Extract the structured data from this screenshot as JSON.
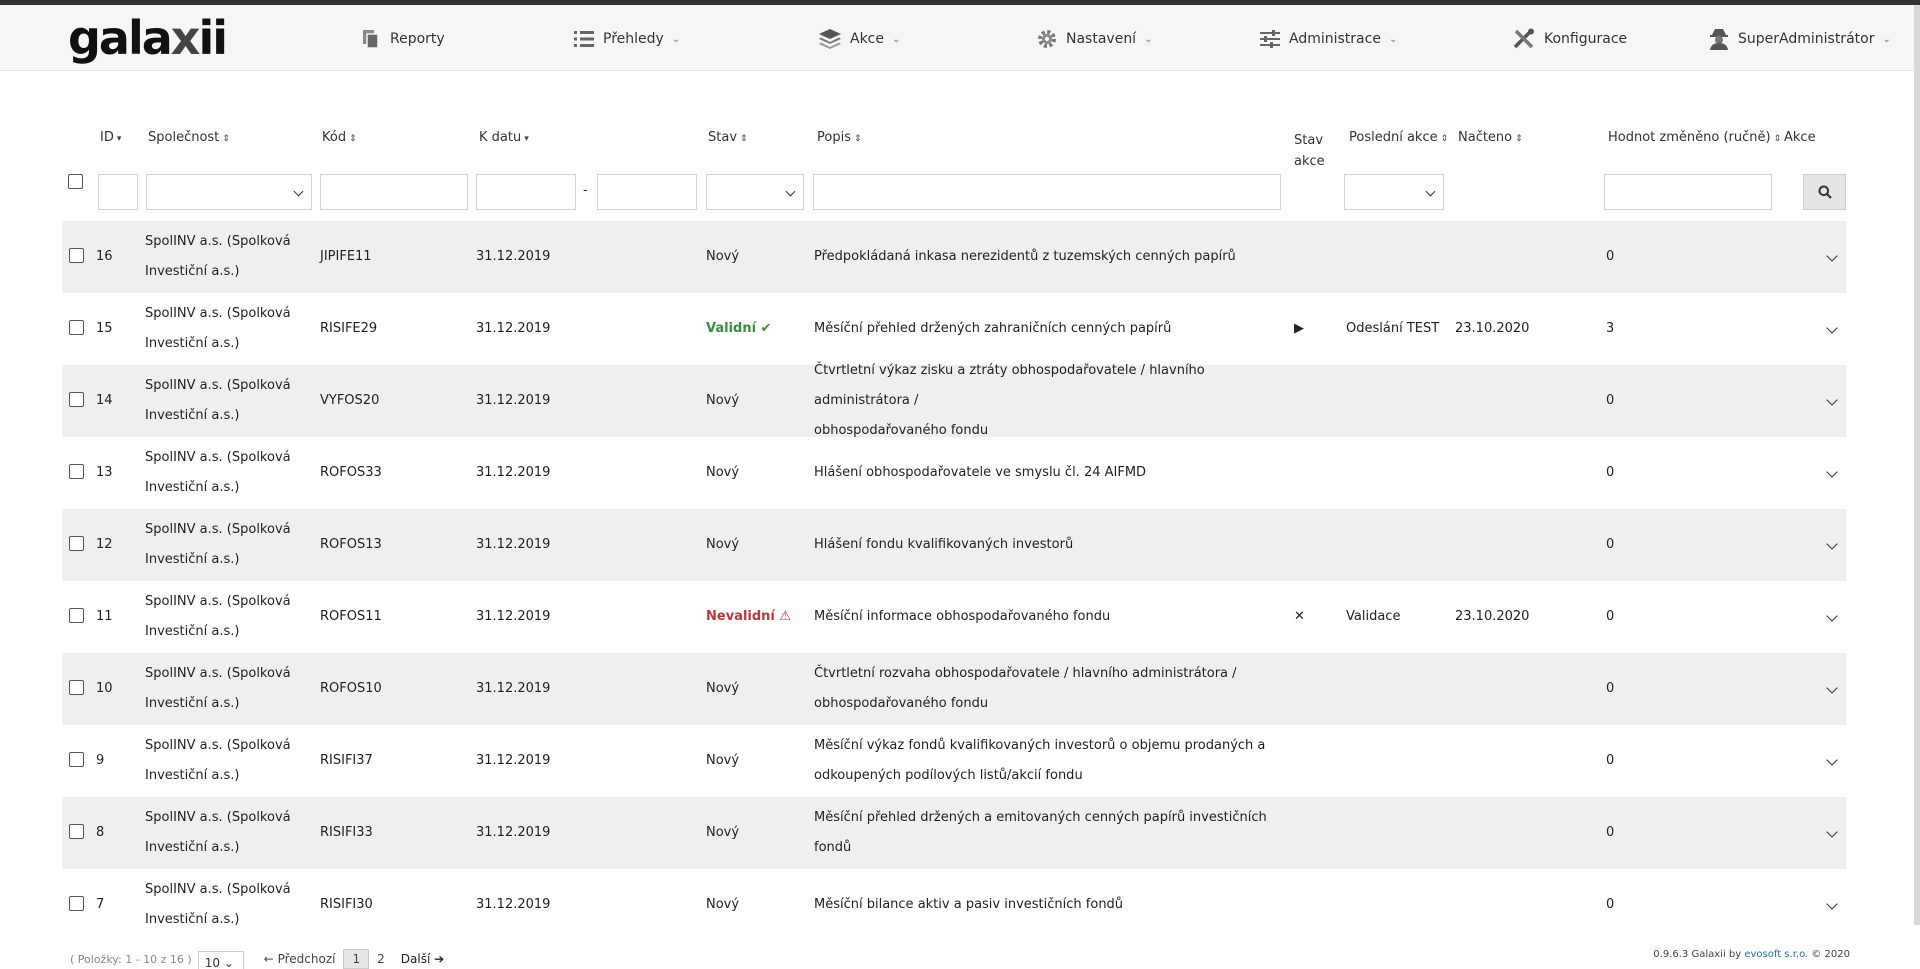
{
  "app": {
    "logo_text_a": "gala",
    "logo_text_x": "x",
    "logo_text_b": "ii"
  },
  "nav": {
    "reporty": "Reporty",
    "prehledy": "Přehledy",
    "akce": "Akce",
    "nastaveni": "Nastavení",
    "administrace": "Administrace",
    "konfigurace": "Konfigurace",
    "superadmin": "SuperAdministrátor"
  },
  "columns": {
    "id": "ID",
    "spolecnost": "Společnost",
    "kod": "Kód",
    "k_datu": "K datu",
    "stav": "Stav",
    "popis": "Popis",
    "stav_akce_1": "Stav",
    "stav_akce_2": "akce",
    "posledni_akce": "Poslední akce",
    "nacteno": "Načteno",
    "hodnot_zmeneno": "Hodnot změněno (ručně)",
    "akce": "Akce"
  },
  "filters": {
    "date_separator": "-"
  },
  "rows": [
    {
      "id": "16",
      "company_1": "SpolINV a.s. (Spolková",
      "company_2": "Investiční a.s.)",
      "code": "JIPIFE11",
      "date": "31.12.2019",
      "status": "Nový",
      "desc_1": "Předpokládaná inkasa nerezidentů z tuzemských cenných papírů",
      "desc_2": "",
      "action_state": "",
      "last_action": "",
      "loaded": "",
      "changed": "0"
    },
    {
      "id": "15",
      "company_1": "SpolINV a.s. (Spolková",
      "company_2": "Investiční a.s.)",
      "code": "RISIFE29",
      "date": "31.12.2019",
      "status": "Validní ✔",
      "desc_1": "Měsíční přehled držených zahraničních cenných papírů",
      "desc_2": "",
      "action_state": "▶",
      "last_action": "Odeslání TEST",
      "loaded": "23.10.2020",
      "changed": "3"
    },
    {
      "id": "14",
      "company_1": "SpolINV a.s. (Spolková",
      "company_2": "Investiční a.s.)",
      "code": "VYFOS20",
      "date": "31.12.2019",
      "status": "Nový",
      "desc_1": "Čtvrtletní výkaz zisku a ztráty obhospodařovatele / hlavního administrátora /",
      "desc_2": "obhospodařovaného fondu",
      "action_state": "",
      "last_action": "",
      "loaded": "",
      "changed": "0"
    },
    {
      "id": "13",
      "company_1": "SpolINV a.s. (Spolková",
      "company_2": "Investiční a.s.)",
      "code": "ROFOS33",
      "date": "31.12.2019",
      "status": "Nový",
      "desc_1": "Hlášení obhospodařovatele ve smyslu čl. 24 AIFMD",
      "desc_2": "",
      "action_state": "",
      "last_action": "",
      "loaded": "",
      "changed": "0"
    },
    {
      "id": "12",
      "company_1": "SpolINV a.s. (Spolková",
      "company_2": "Investiční a.s.)",
      "code": "ROFOS13",
      "date": "31.12.2019",
      "status": "Nový",
      "desc_1": "Hlášení fondu kvalifikovaných investorů",
      "desc_2": "",
      "action_state": "",
      "last_action": "",
      "loaded": "",
      "changed": "0"
    },
    {
      "id": "11",
      "company_1": "SpolINV a.s. (Spolková",
      "company_2": "Investiční a.s.)",
      "code": "ROFOS11",
      "date": "31.12.2019",
      "status": "Nevalidní ⚠",
      "desc_1": "Měsíční informace obhospodařovaného fondu",
      "desc_2": "",
      "action_state": "✕",
      "last_action": "Validace",
      "loaded": "23.10.2020",
      "changed": "0"
    },
    {
      "id": "10",
      "company_1": "SpolINV a.s. (Spolková",
      "company_2": "Investiční a.s.)",
      "code": "ROFOS10",
      "date": "31.12.2019",
      "status": "Nový",
      "desc_1": "Čtvrtletní rozvaha obhospodařovatele / hlavního administrátora /",
      "desc_2": "obhospodařovaného fondu",
      "action_state": "",
      "last_action": "",
      "loaded": "",
      "changed": "0"
    },
    {
      "id": "9",
      "company_1": "SpolINV a.s. (Spolková",
      "company_2": "Investiční a.s.)",
      "code": "RISIFI37",
      "date": "31.12.2019",
      "status": "Nový",
      "desc_1": "Měsíční výkaz fondů kvalifikovaných investorů o objemu prodaných a",
      "desc_2": "odkoupených podílových listů/akcií fondu",
      "action_state": "",
      "last_action": "",
      "loaded": "",
      "changed": "0"
    },
    {
      "id": "8",
      "company_1": "SpolINV a.s. (Spolková",
      "company_2": "Investiční a.s.)",
      "code": "RISIFI33",
      "date": "31.12.2019",
      "status": "Nový",
      "desc_1": "Měsíční přehled držených a emitovaných cenných papírů investičních fondů",
      "desc_2": "",
      "action_state": "",
      "last_action": "",
      "loaded": "",
      "changed": "0"
    },
    {
      "id": "7",
      "company_1": "SpolINV a.s. (Spolková",
      "company_2": "Investiční a.s.)",
      "code": "RISIFI30",
      "date": "31.12.2019",
      "status": "Nový",
      "desc_1": "Měsíční bilance aktiv a pasiv investičních fondů",
      "desc_2": "",
      "action_state": "",
      "last_action": "",
      "loaded": "",
      "changed": "0"
    }
  ],
  "pager": {
    "items_info": "( Položky: 1 - 10 z 16 )",
    "page_size": "10",
    "prev": "← Předchozí",
    "page1": "1",
    "page2": "2",
    "next": "Další ➔"
  },
  "footer": {
    "version": "0.9.6.3 Galaxii by ",
    "company": "evosoft s.r.o.",
    "copyright": " © 2020"
  }
}
